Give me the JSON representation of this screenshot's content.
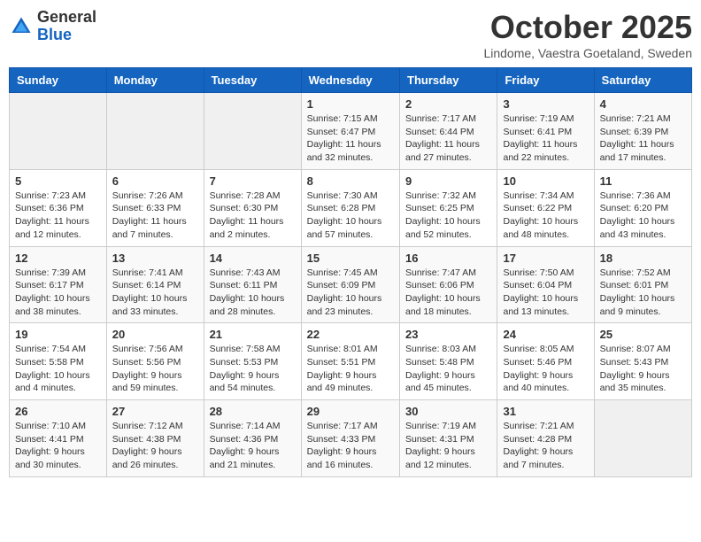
{
  "header": {
    "logo_general": "General",
    "logo_blue": "Blue",
    "month_title": "October 2025",
    "subtitle": "Lindome, Vaestra Goetaland, Sweden"
  },
  "weekdays": [
    "Sunday",
    "Monday",
    "Tuesday",
    "Wednesday",
    "Thursday",
    "Friday",
    "Saturday"
  ],
  "weeks": [
    [
      {
        "day": "",
        "info": ""
      },
      {
        "day": "",
        "info": ""
      },
      {
        "day": "",
        "info": ""
      },
      {
        "day": "1",
        "info": "Sunrise: 7:15 AM\nSunset: 6:47 PM\nDaylight: 11 hours\nand 32 minutes."
      },
      {
        "day": "2",
        "info": "Sunrise: 7:17 AM\nSunset: 6:44 PM\nDaylight: 11 hours\nand 27 minutes."
      },
      {
        "day": "3",
        "info": "Sunrise: 7:19 AM\nSunset: 6:41 PM\nDaylight: 11 hours\nand 22 minutes."
      },
      {
        "day": "4",
        "info": "Sunrise: 7:21 AM\nSunset: 6:39 PM\nDaylight: 11 hours\nand 17 minutes."
      }
    ],
    [
      {
        "day": "5",
        "info": "Sunrise: 7:23 AM\nSunset: 6:36 PM\nDaylight: 11 hours\nand 12 minutes."
      },
      {
        "day": "6",
        "info": "Sunrise: 7:26 AM\nSunset: 6:33 PM\nDaylight: 11 hours\nand 7 minutes."
      },
      {
        "day": "7",
        "info": "Sunrise: 7:28 AM\nSunset: 6:30 PM\nDaylight: 11 hours\nand 2 minutes."
      },
      {
        "day": "8",
        "info": "Sunrise: 7:30 AM\nSunset: 6:28 PM\nDaylight: 10 hours\nand 57 minutes."
      },
      {
        "day": "9",
        "info": "Sunrise: 7:32 AM\nSunset: 6:25 PM\nDaylight: 10 hours\nand 52 minutes."
      },
      {
        "day": "10",
        "info": "Sunrise: 7:34 AM\nSunset: 6:22 PM\nDaylight: 10 hours\nand 48 minutes."
      },
      {
        "day": "11",
        "info": "Sunrise: 7:36 AM\nSunset: 6:20 PM\nDaylight: 10 hours\nand 43 minutes."
      }
    ],
    [
      {
        "day": "12",
        "info": "Sunrise: 7:39 AM\nSunset: 6:17 PM\nDaylight: 10 hours\nand 38 minutes."
      },
      {
        "day": "13",
        "info": "Sunrise: 7:41 AM\nSunset: 6:14 PM\nDaylight: 10 hours\nand 33 minutes."
      },
      {
        "day": "14",
        "info": "Sunrise: 7:43 AM\nSunset: 6:11 PM\nDaylight: 10 hours\nand 28 minutes."
      },
      {
        "day": "15",
        "info": "Sunrise: 7:45 AM\nSunset: 6:09 PM\nDaylight: 10 hours\nand 23 minutes."
      },
      {
        "day": "16",
        "info": "Sunrise: 7:47 AM\nSunset: 6:06 PM\nDaylight: 10 hours\nand 18 minutes."
      },
      {
        "day": "17",
        "info": "Sunrise: 7:50 AM\nSunset: 6:04 PM\nDaylight: 10 hours\nand 13 minutes."
      },
      {
        "day": "18",
        "info": "Sunrise: 7:52 AM\nSunset: 6:01 PM\nDaylight: 10 hours\nand 9 minutes."
      }
    ],
    [
      {
        "day": "19",
        "info": "Sunrise: 7:54 AM\nSunset: 5:58 PM\nDaylight: 10 hours\nand 4 minutes."
      },
      {
        "day": "20",
        "info": "Sunrise: 7:56 AM\nSunset: 5:56 PM\nDaylight: 9 hours\nand 59 minutes."
      },
      {
        "day": "21",
        "info": "Sunrise: 7:58 AM\nSunset: 5:53 PM\nDaylight: 9 hours\nand 54 minutes."
      },
      {
        "day": "22",
        "info": "Sunrise: 8:01 AM\nSunset: 5:51 PM\nDaylight: 9 hours\nand 49 minutes."
      },
      {
        "day": "23",
        "info": "Sunrise: 8:03 AM\nSunset: 5:48 PM\nDaylight: 9 hours\nand 45 minutes."
      },
      {
        "day": "24",
        "info": "Sunrise: 8:05 AM\nSunset: 5:46 PM\nDaylight: 9 hours\nand 40 minutes."
      },
      {
        "day": "25",
        "info": "Sunrise: 8:07 AM\nSunset: 5:43 PM\nDaylight: 9 hours\nand 35 minutes."
      }
    ],
    [
      {
        "day": "26",
        "info": "Sunrise: 7:10 AM\nSunset: 4:41 PM\nDaylight: 9 hours\nand 30 minutes."
      },
      {
        "day": "27",
        "info": "Sunrise: 7:12 AM\nSunset: 4:38 PM\nDaylight: 9 hours\nand 26 minutes."
      },
      {
        "day": "28",
        "info": "Sunrise: 7:14 AM\nSunset: 4:36 PM\nDaylight: 9 hours\nand 21 minutes."
      },
      {
        "day": "29",
        "info": "Sunrise: 7:17 AM\nSunset: 4:33 PM\nDaylight: 9 hours\nand 16 minutes."
      },
      {
        "day": "30",
        "info": "Sunrise: 7:19 AM\nSunset: 4:31 PM\nDaylight: 9 hours\nand 12 minutes."
      },
      {
        "day": "31",
        "info": "Sunrise: 7:21 AM\nSunset: 4:28 PM\nDaylight: 9 hours\nand 7 minutes."
      },
      {
        "day": "",
        "info": ""
      }
    ]
  ]
}
